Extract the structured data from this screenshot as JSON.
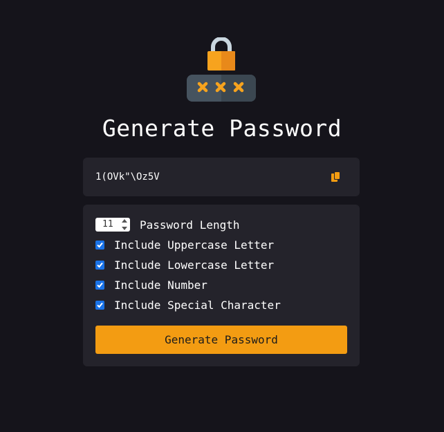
{
  "header": {
    "title": "Generate Password",
    "logo_icon": "lock-asterisks-icon"
  },
  "result": {
    "password": "1(OVk\"\\Oz5V",
    "copy_icon": "copy-icon"
  },
  "settings": {
    "length_value": "11",
    "length_label": "Password Length",
    "options": [
      {
        "label": "Include Uppercase Letter",
        "checked": true
      },
      {
        "label": "Include Lowercase Letter",
        "checked": true
      },
      {
        "label": "Include Number",
        "checked": true
      },
      {
        "label": "Include Special Character",
        "checked": true
      }
    ],
    "generate_label": "Generate Password"
  },
  "colors": {
    "background": "#15141b",
    "panel": "#24232b",
    "accent": "#f39c12",
    "checkbox": "#1a73e8"
  }
}
